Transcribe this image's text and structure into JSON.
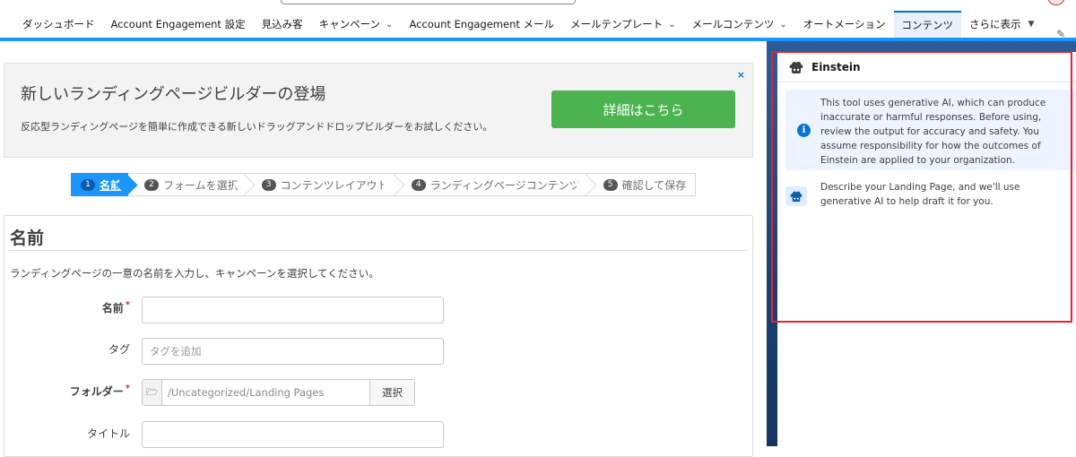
{
  "nav": {
    "items": [
      {
        "label": "ダッシュボード",
        "dropdown": false
      },
      {
        "label": "Account Engagement 設定",
        "dropdown": false
      },
      {
        "label": "見込み客",
        "dropdown": false
      },
      {
        "label": "キャンペーン",
        "dropdown": true
      },
      {
        "label": "Account Engagement メール",
        "dropdown": false
      },
      {
        "label": "メールテンプレート",
        "dropdown": true
      },
      {
        "label": "メールコンテンツ",
        "dropdown": true
      },
      {
        "label": "オートメーション",
        "dropdown": false
      },
      {
        "label": "コンテンツ",
        "dropdown": false,
        "active": true
      }
    ],
    "more_label": "さらに表示"
  },
  "banner": {
    "title": "新しいランディングページビルダーの登場",
    "description": "反応型ランディングページを簡単に作成できる新しいドラッグアンドドロップビルダーをお試しください。",
    "button_label": "詳細はこちら",
    "close_glyph": "×"
  },
  "stepper": {
    "steps": [
      {
        "num": "1",
        "label": "名前",
        "active": true
      },
      {
        "num": "2",
        "label": "フォームを選択"
      },
      {
        "num": "3",
        "label": "コンテンツレイアウト"
      },
      {
        "num": "4",
        "label": "ランディングページコンテンツ"
      },
      {
        "num": "5",
        "label": "確認して保存"
      }
    ]
  },
  "form": {
    "heading": "名前",
    "description": "ランディングページの一意の名前を入力し、キャンペーンを選択してください。",
    "name_label": "名前",
    "tag_label": "タグ",
    "tag_placeholder": "タグを追加",
    "folder_label": "フォルダー",
    "folder_path": "/Uncategorized/Landing Pages",
    "folder_button": "選択",
    "title_label": "タイトル",
    "required_mark": "*"
  },
  "einstein": {
    "title": "Einstein",
    "notice": "This tool uses generative AI, which can produce inaccurate or harmful responses. Before using, review the output for accuracy and safety. You assume responsibility for how the outcomes of Einstein are applied to your organization.",
    "message": "Describe your Landing Page, and we'll use generative AI to help draft it for you."
  },
  "icons": {
    "chevron": "chevron-down-icon",
    "pencil": "pencil-icon",
    "info": "info-icon",
    "einstein": "einstein-icon",
    "folder": "folder-icon"
  },
  "colors": {
    "brand_blue": "#0176d3",
    "active_step": "#1b96ff",
    "green_button": "#4bb350",
    "highlight_red": "#e8212a"
  }
}
